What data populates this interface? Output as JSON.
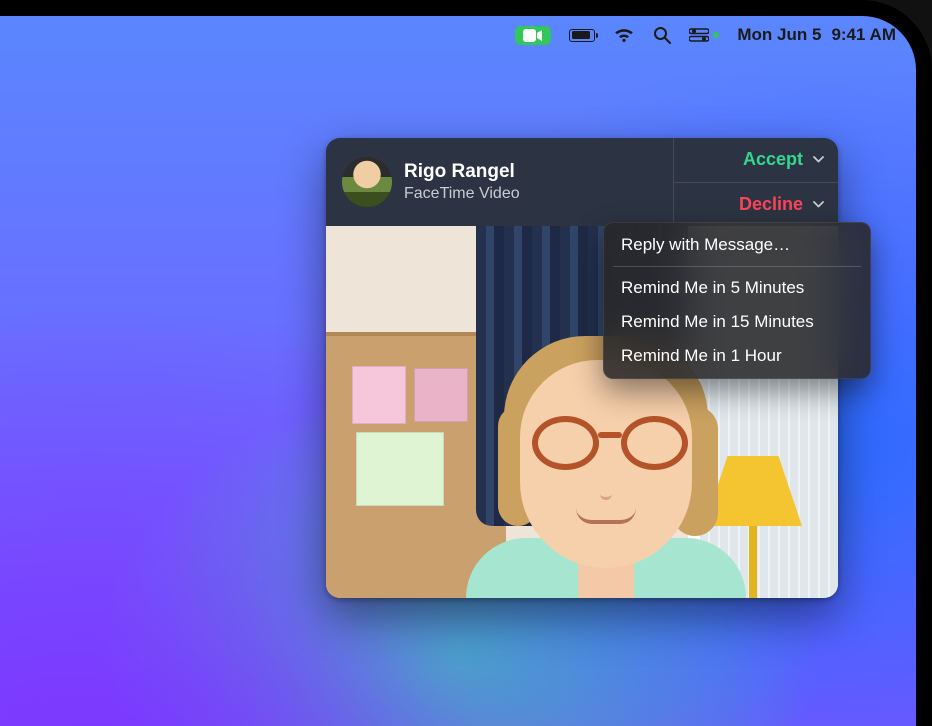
{
  "menubar": {
    "date": "Mon Jun 5",
    "time": "9:41 AM"
  },
  "notification": {
    "caller_name": "Rigo Rangel",
    "call_type": "FaceTime Video",
    "accept_label": "Accept",
    "decline_label": "Decline"
  },
  "dropdown": {
    "reply": "Reply with Message…",
    "remind5": "Remind Me in 5 Minutes",
    "remind15": "Remind Me in 15 Minutes",
    "remind60": "Remind Me in 1 Hour"
  },
  "colors": {
    "accept": "#33d790",
    "decline": "#ff4458",
    "facetime_status": "#31c75a"
  }
}
